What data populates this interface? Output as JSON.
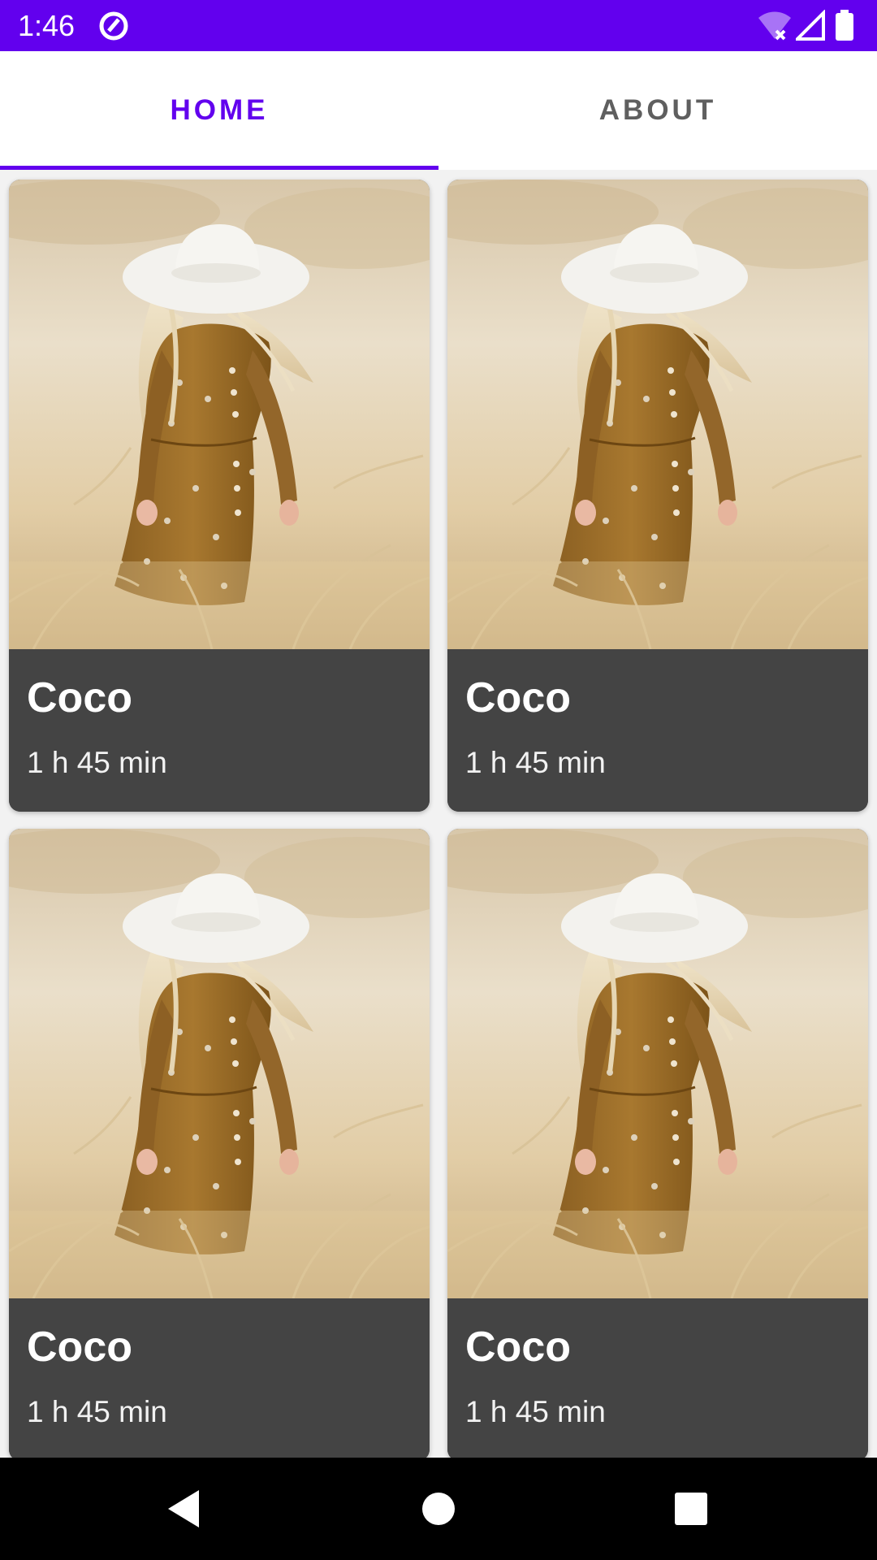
{
  "status_bar": {
    "time": "1:46",
    "background_color": "#6200ee",
    "icons": [
      "app-notification-icon",
      "wifi-off-icon",
      "cell-signal-icon",
      "battery-icon"
    ]
  },
  "tabs": [
    {
      "label": "HOME",
      "selected": true
    },
    {
      "label": "ABOUT",
      "selected": false
    }
  ],
  "accent_color": "#6200ee",
  "cards": [
    {
      "title": "Coco",
      "duration": "1 h 45 min",
      "image": "girl-in-hat-field-photo"
    },
    {
      "title": "Coco",
      "duration": "1 h 45 min",
      "image": "girl-in-hat-field-photo"
    },
    {
      "title": "Coco",
      "duration": "1 h 45 min",
      "image": "girl-in-hat-field-photo"
    },
    {
      "title": "Coco",
      "duration": "1 h 45 min",
      "image": "girl-in-hat-field-photo"
    }
  ],
  "nav_bar": {
    "buttons": [
      "back-icon",
      "home-icon",
      "recents-icon"
    ]
  }
}
